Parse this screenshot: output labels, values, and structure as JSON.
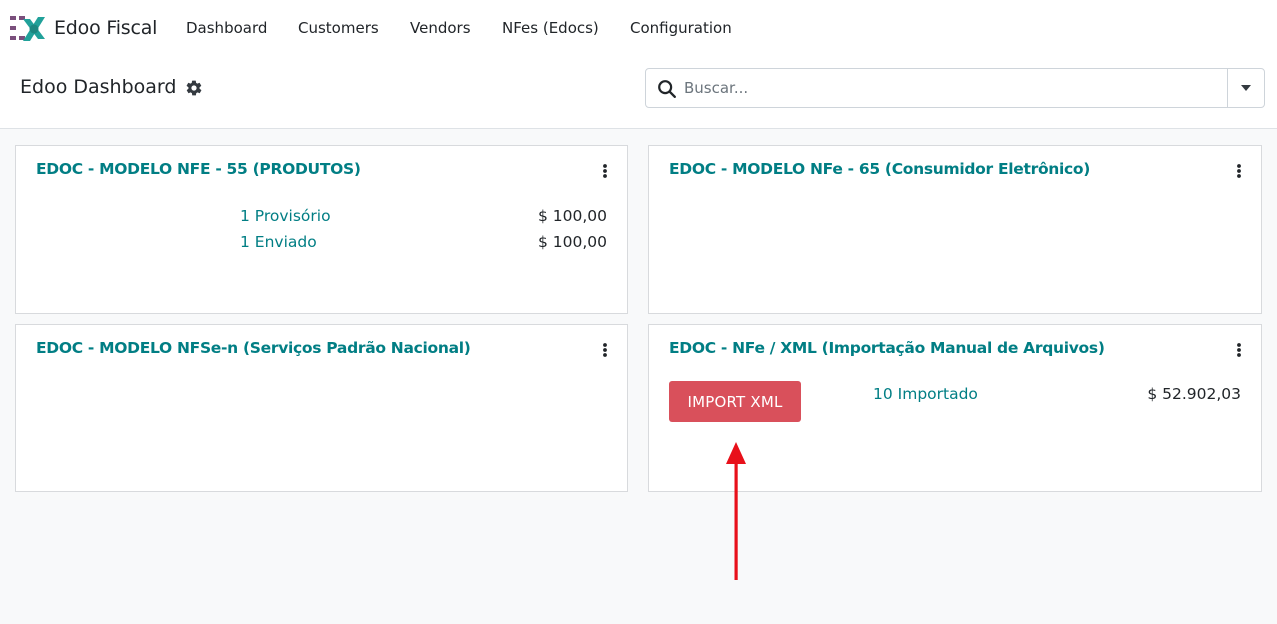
{
  "app": {
    "name": "Edoo Fiscal",
    "logo_icon": "edoo-logo-icon"
  },
  "nav": {
    "items": [
      {
        "label": "Dashboard"
      },
      {
        "label": "Customers"
      },
      {
        "label": "Vendors"
      },
      {
        "label": "NFes (Edocs)"
      },
      {
        "label": "Configuration"
      }
    ]
  },
  "control": {
    "title": "Edoo Dashboard",
    "settings_icon": "gear-icon",
    "search": {
      "placeholder": "Buscar...",
      "value": ""
    }
  },
  "cards": [
    {
      "title": "EDOC - MODELO NFE - 55 (PRODUTOS)",
      "rows": [
        {
          "label": "1 Provisório",
          "amount": "$ 100,00"
        },
        {
          "label": "1 Enviado",
          "amount": "$ 100,00"
        }
      ]
    },
    {
      "title": "EDOC - MODELO NFe - 65 (Consumidor Eletrônico)",
      "rows": []
    },
    {
      "title": "EDOC - MODELO NFSe-n (Serviços Padrão Nacional)",
      "rows": []
    },
    {
      "title": "EDOC - NFe / XML (Importação Manual de Arquivos)",
      "button_label": "IMPORT XML",
      "rows": [
        {
          "label": "10 Importado",
          "amount": "$ 52.902,03"
        }
      ]
    }
  ],
  "colors": {
    "accent": "#017e84",
    "import_button": "#d9505b",
    "annotation_arrow": "#e8101a",
    "background": "#f8f9fa"
  }
}
